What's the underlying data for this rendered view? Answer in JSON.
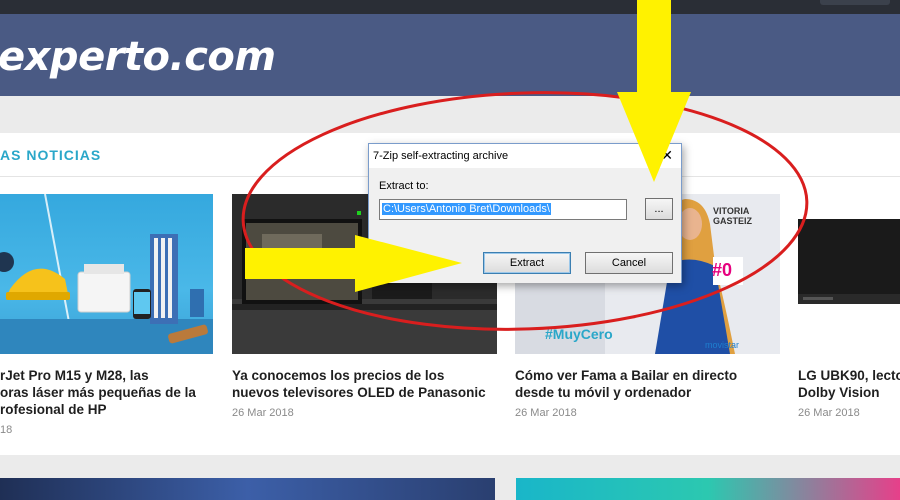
{
  "site": {
    "logo_text": "experto.com",
    "section_title": "AS NOTICIAS"
  },
  "news": [
    {
      "title": "rJet Pro M15 y M28, las\noras láser más pequeñas de la\nrofesional de HP",
      "date": "18"
    },
    {
      "title": "Ya conocemos los precios de los\nnuevos televisores OLED de Panasonic",
      "date": "26 Mar 2018"
    },
    {
      "title": "Cómo ver Fama a Bailar en directo\ndesde tu móvil y ordenador",
      "date": "26 Mar 2018"
    },
    {
      "title": "LG UBK90, lecto\nDolby Vision",
      "date": "26 Mar 2018"
    }
  ],
  "image_text": {
    "vitoria": "VITORIA\nGASTEIZ",
    "hashtag": "#MuyCero",
    "hash_zero": "#0",
    "movistar": "movistar"
  },
  "dialog": {
    "title": "7-Zip self-extracting archive",
    "close_symbol": "✕",
    "extract_label": "Extract to:",
    "path_value": "C:\\Users\\Antonio Bret\\Downloads\\",
    "browse_label": "...",
    "extract_button": "Extract",
    "cancel_button": "Cancel"
  },
  "colors": {
    "header": "#4a5a84",
    "section_title": "#2aa7c9",
    "annotation_arrow": "#fff200",
    "annotation_ellipse": "#d91e1e"
  }
}
